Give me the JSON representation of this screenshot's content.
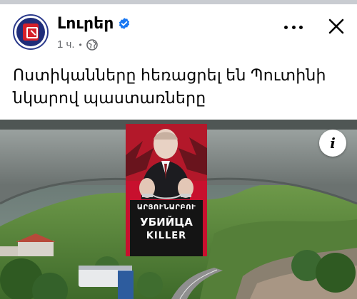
{
  "post": {
    "page_name": "Լուրեր",
    "timestamp": "1 ч.",
    "separator": "•",
    "caption": "Ոստիկանները հեռացրել են Պուտինի նկարով պաստառները",
    "banner_text": {
      "line1": "ԱՐՅՈՒՆԱՐԲՈՒ",
      "line2": "УБИЙЦА",
      "line3": "KILLER"
    },
    "info_label": "i"
  },
  "icons": {
    "verified": "verified-badge-icon",
    "audience": "globe-icon",
    "more": "more-options-icon",
    "close": "close-icon",
    "info": "info-icon"
  },
  "colors": {
    "verified_blue": "#1877f2",
    "banner_red": "#c8102e",
    "text_primary": "#050505",
    "text_secondary": "#65676b"
  }
}
